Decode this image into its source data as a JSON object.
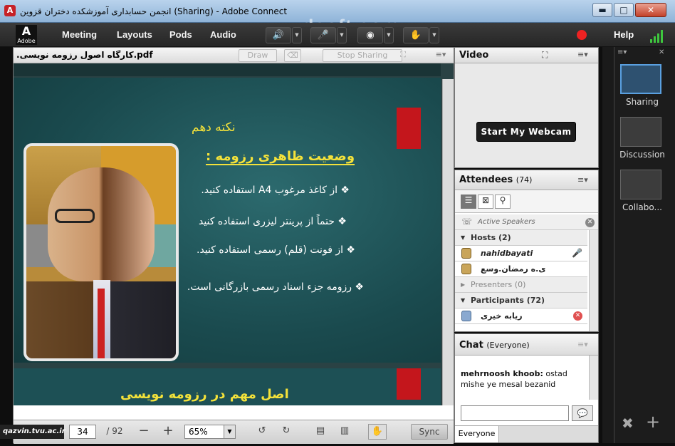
{
  "window": {
    "title": "انجمن حسابداری آموزشکده دختران قزوین (Sharing) - Adobe Connect",
    "minimize": "▬",
    "maximize": "□",
    "close": "✕"
  },
  "menubar": {
    "logo_text": "Adobe",
    "items": [
      "Meeting",
      "Layouts",
      "Pods",
      "Audio"
    ],
    "help": "Help",
    "watermark": "www.zdsoft.com"
  },
  "share_pod": {
    "filename": ".کارگاه اصول رزومه نویسی.pdf",
    "draw_button": "Draw",
    "stop_sharing_button": "Stop Sharing",
    "slide": {
      "heading": "نکته دهم",
      "subheading": "وضعیت ظاهری رزومه :",
      "bullets": [
        "از کاغذ مرغوب A4 استفاده کنید.",
        "حتماً از پرینتر لیزری استفاده کنید",
        "از فونت (قلم) رسمی استفاده کنید.",
        "رزومه جزء اسناد رسمی بازرگانی است."
      ],
      "next_heading": "اصل مهم در رزومه نویسی"
    },
    "footer": {
      "page_current": "34",
      "page_total": "/ 92",
      "zoom": "65%",
      "sync": "Sync"
    }
  },
  "video_pod": {
    "title": "Video",
    "webcam_button": "Start My Webcam"
  },
  "attendees_pod": {
    "title": "Attendees",
    "count": "(74)",
    "active_speakers": "Active Speakers",
    "groups": {
      "hosts": "Hosts (2)",
      "presenters": "Presenters (0)",
      "participants": "Participants (72)"
    },
    "hosts": [
      "nahidbayati",
      "ی.ه رمضان.وسع"
    ],
    "participants": [
      "ریابه خیری"
    ]
  },
  "chat_pod": {
    "title": "Chat",
    "scope": "(Everyone)",
    "messages": [
      {
        "sender": "mehrnoosh khoob:",
        "text": "ostad mishe ye mesal bezanid"
      }
    ],
    "tab": "Everyone"
  },
  "layouts_dock": {
    "items": [
      "Sharing",
      "Discussion",
      "Collabo..."
    ],
    "selected": "Sharing"
  },
  "overlay": {
    "site": "qazvin.tvu.ac.ir"
  },
  "colors": {
    "slide_bg": "#1a4a4e",
    "slide_accent": "#c4161c",
    "slide_heading": "#f4e23a",
    "dock_selected": "#5aa0e0"
  }
}
